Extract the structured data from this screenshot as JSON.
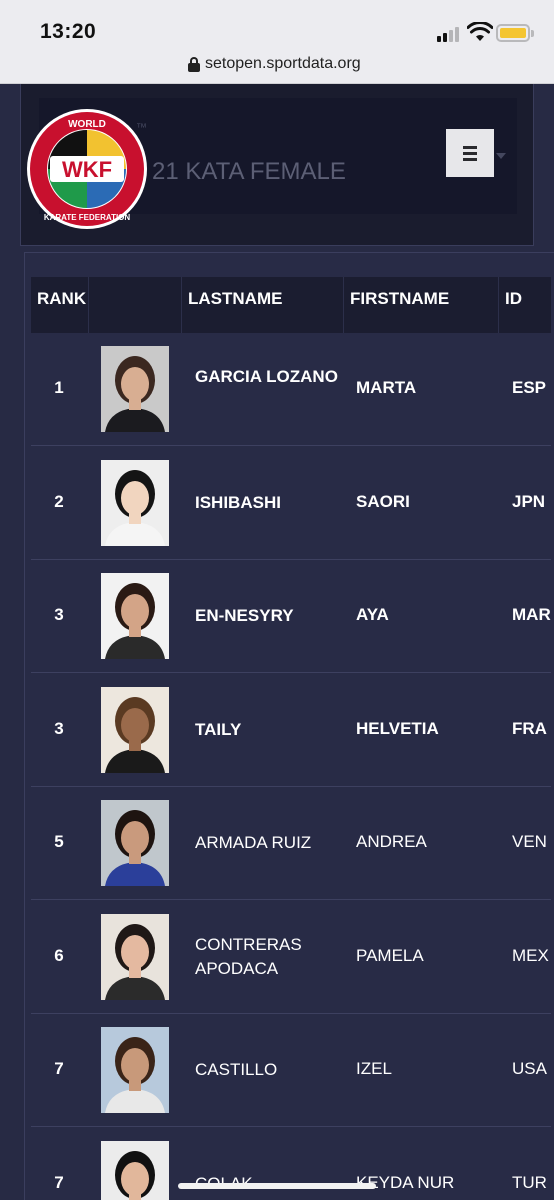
{
  "status_bar": {
    "time": "13:20"
  },
  "browser": {
    "url": "setopen.sportdata.org"
  },
  "header": {
    "title": "21 KATA FEMALE",
    "small_text": "™",
    "logo_text_top": "WORLD",
    "logo_text_mid": "WKF",
    "logo_text_bottom": "KARATE FEDERATION"
  },
  "table": {
    "columns": [
      "RANK",
      "",
      "LASTNAME",
      "FIRSTNAME",
      "ID"
    ],
    "rows": [
      {
        "rank": "1",
        "lastname": "GARCIA LOZANO",
        "lastname_bold": true,
        "firstname": "MARTA",
        "firstname_bold": true,
        "id": "ESP",
        "photo_bg": "#c9c9c9",
        "skin": "#d8ae92",
        "hair": "#3b2820",
        "shirt": "#1b1b1f"
      },
      {
        "rank": "2",
        "lastname": "ISHIBASHI",
        "lastname_bold": true,
        "firstname": "SAORI",
        "firstname_bold": true,
        "id": "JPN",
        "photo_bg": "#eeeeee",
        "skin": "#f1d5bf",
        "hair": "#141414",
        "shirt": "#f5f5f5"
      },
      {
        "rank": "3",
        "lastname": "EN-NESYRY",
        "lastname_bold": true,
        "firstname": "AYA",
        "firstname_bold": true,
        "id": "MAR",
        "photo_bg": "#f2f2f2",
        "skin": "#d3a487",
        "hair": "#2a1a14",
        "shirt": "#2a2a2a"
      },
      {
        "rank": "3",
        "lastname": "TAILY",
        "lastname_bold": true,
        "firstname": "HELVETIA",
        "firstname_bold": true,
        "id": "FRA",
        "photo_bg": "#ede7de",
        "skin": "#9a6a4b",
        "hair": "#5a3a22",
        "shirt": "#1a1a1a"
      },
      {
        "rank": "5",
        "lastname": "ARMADA RUIZ",
        "lastname_bold": false,
        "firstname": "ANDREA",
        "firstname_bold": false,
        "id": "VEN",
        "photo_bg": "#c0c7cc",
        "skin": "#c99a7d",
        "hair": "#1e1410",
        "shirt": "#2b3f9a"
      },
      {
        "rank": "6",
        "lastname": "CONTRERAS APODACA",
        "lastname_bold": false,
        "firstname": "PAMELA",
        "firstname_bold": false,
        "id": "MEX",
        "photo_bg": "#e8e3dc",
        "skin": "#e4b9a0",
        "hair": "#1f1816",
        "shirt": "#2b2b2b"
      },
      {
        "rank": "7",
        "lastname": "CASTILLO",
        "lastname_bold": false,
        "firstname": "IZEL",
        "firstname_bold": false,
        "id": "USA",
        "photo_bg": "#b7c9dc",
        "skin": "#c8997a",
        "hair": "#3a2418",
        "shirt": "#e8e8e8"
      },
      {
        "rank": "7",
        "lastname": "COLAK",
        "lastname_bold": false,
        "firstname": "KEYDA NUR",
        "firstname_bold": false,
        "id": "TUR",
        "photo_bg": "#ececec",
        "skin": "#e1b79b",
        "hair": "#111111",
        "shirt": "#111111"
      }
    ]
  },
  "colors": {
    "page_bg": "#272a44",
    "table_header_bg": "#1b1d30",
    "menu_button_bg": "#e7e7ea",
    "battery": "#f4c531"
  },
  "icons": [
    "lock-icon",
    "wifi-icon",
    "signal-icon",
    "battery-icon",
    "menu-icon",
    "caret-down-icon"
  ]
}
